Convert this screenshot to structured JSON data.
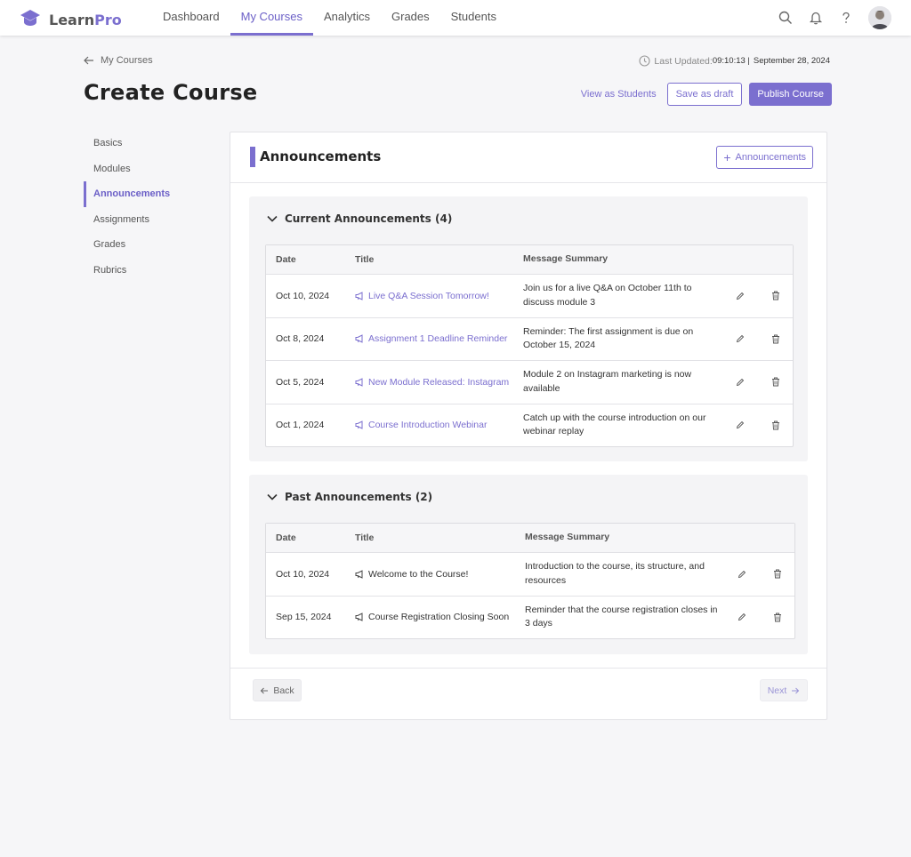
{
  "brand": {
    "name_part1": "Learn",
    "name_part2": "Pro",
    "accent_color": "#7b6fcf"
  },
  "nav": {
    "links": [
      {
        "label": "Dashboard",
        "active": false
      },
      {
        "label": "My Courses",
        "active": true
      },
      {
        "label": "Analytics",
        "active": false
      },
      {
        "label": "Grades",
        "active": false
      },
      {
        "label": "Students",
        "active": false
      }
    ],
    "icons": [
      "search-icon",
      "bell-icon",
      "help-icon",
      "avatar"
    ]
  },
  "header": {
    "breadcrumb": "My Courses",
    "last_updated_label": "Last Updated:",
    "last_updated_time": "09:10:13 |",
    "last_updated_date": "September 28, 2024",
    "title": "Create Course",
    "view_students": "View as Students",
    "save_draft": "Save as draft",
    "publish": "Publish Course"
  },
  "sidebar": {
    "items": [
      {
        "label": "Basics",
        "active": false
      },
      {
        "label": "Modules",
        "active": false
      },
      {
        "label": "Announcements",
        "active": true
      },
      {
        "label": "Assignments",
        "active": false
      },
      {
        "label": "Grades",
        "active": false
      },
      {
        "label": "Rubrics",
        "active": false
      }
    ]
  },
  "card": {
    "title": "Announcements",
    "add_button": "Announcements",
    "columns": {
      "date": "Date",
      "title": "Title",
      "message": "Message Summary"
    },
    "current": {
      "heading": "Current Announcements (4)",
      "rows": [
        {
          "date": "Oct 10, 2024",
          "title": "Live Q&A Session Tomorrow!",
          "message": "Join us for a live Q&A on October 11th to discuss module 3"
        },
        {
          "date": "Oct 8, 2024",
          "title": "Assignment 1 Deadline Reminder",
          "message": "Reminder: The first assignment is due on October 15, 2024"
        },
        {
          "date": "Oct 5, 2024",
          "title": "New Module Released: Instagram",
          "message": "Module 2 on Instagram marketing is now available"
        },
        {
          "date": "Oct 1, 2024",
          "title": "Course Introduction Webinar",
          "message": "Catch up with the course introduction on our webinar replay"
        }
      ]
    },
    "past": {
      "heading": "Past Announcements (2)",
      "rows": [
        {
          "date": "Oct 10, 2024",
          "title": "Welcome to the Course!",
          "message": "Introduction to the course, its structure, and resources"
        },
        {
          "date": "Sep 15, 2024",
          "title": "Course Registration Closing Soon",
          "message": "Reminder that the course registration closes in 3 days"
        }
      ]
    },
    "back": "Back",
    "next": "Next"
  }
}
